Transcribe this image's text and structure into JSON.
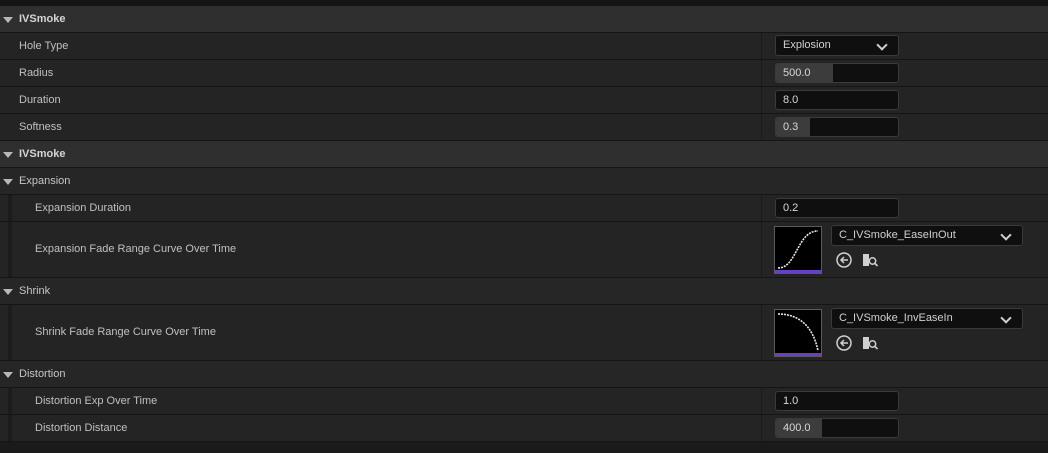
{
  "sections": {
    "ivsmoke_main": {
      "title": "IVSmoke",
      "hole_type": {
        "label": "Hole Type",
        "value": "Explosion"
      },
      "radius": {
        "label": "Radius",
        "value": "500.0",
        "slider_fraction": 0.47
      },
      "duration": {
        "label": "Duration",
        "value": "8.0"
      },
      "softness": {
        "label": "Softness",
        "value": "0.3",
        "slider_fraction": 0.28
      }
    },
    "ivsmoke_second": {
      "title": "IVSmoke"
    },
    "expansion": {
      "title": "Expansion",
      "duration": {
        "label": "Expansion Duration",
        "value": "0.2"
      },
      "fade_curve": {
        "label": "Expansion Fade Range Curve Over Time",
        "asset": "C_IVSmoke_EaseInOut",
        "curve_icon": "ease-in-out-curve-icon"
      }
    },
    "shrink": {
      "title": "Shrink",
      "fade_curve": {
        "label": "Shrink Fade Range Curve Over Time",
        "asset": "C_IVSmoke_InvEaseIn",
        "curve_icon": "inverse-ease-in-curve-icon"
      }
    },
    "distortion": {
      "title": "Distortion",
      "exp_over_time": {
        "label": "Distortion Exp Over Time",
        "value": "1.0"
      },
      "distance": {
        "label": "Distortion Distance",
        "value": "400.0",
        "slider_fraction": 0.38
      }
    }
  },
  "icons": {
    "collapse": "triangle-down-icon",
    "dropdown": "chevron-down-icon",
    "use_selected": "arrow-left-circle-icon",
    "browse": "browse-asset-icon"
  },
  "colors": {
    "category_bg": "#2f2f2f",
    "row_bg": "#242424",
    "field_bg": "#0f0f0f",
    "curve_accent": "#6a3fc4"
  }
}
